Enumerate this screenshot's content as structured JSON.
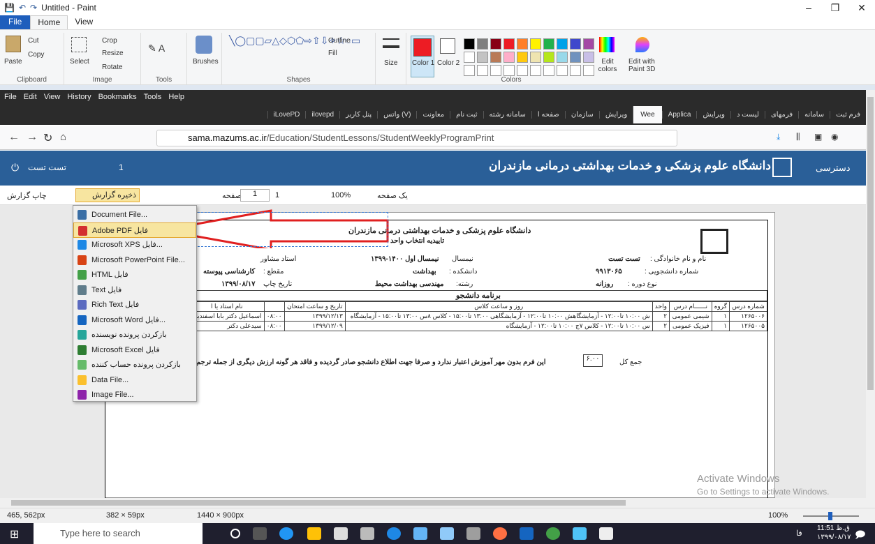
{
  "paint": {
    "title": "Untitled - Paint",
    "tabs": [
      "File",
      "Home",
      "View"
    ],
    "clipboard": {
      "paste": "Paste",
      "cut": "Cut",
      "copy": "Copy",
      "label": "Clipboard"
    },
    "image": {
      "select": "Select",
      "crop": "Crop",
      "resize": "Resize",
      "rotate": "Rotate",
      "label": "Image"
    },
    "tools": {
      "label": "Tools",
      "brushes": "Brushes"
    },
    "shapes": {
      "outline": "Outline",
      "fill": "Fill",
      "label": "Shapes"
    },
    "size": "Size",
    "color1": "Color 1",
    "color2": "Color 2",
    "colors_label": "Colors",
    "edit_colors": "Edit colors",
    "edit_3d": "Edit with Paint 3D",
    "palette": [
      "#000000",
      "#7f7f7f",
      "#880015",
      "#ed1c24",
      "#ff7f27",
      "#fff200",
      "#22b14c",
      "#00a2e8",
      "#3f48cc",
      "#a349a4",
      "#ffffff",
      "#c3c3c3",
      "#b97a57",
      "#ffaec9",
      "#ffc90e",
      "#efe4b0",
      "#b5e61d",
      "#99d9ea",
      "#7092be",
      "#c8bfe7"
    ]
  },
  "firefox": {
    "menu": [
      "File",
      "Edit",
      "View",
      "History",
      "Bookmarks",
      "Tools",
      "Help"
    ],
    "tabs": [
      "فرم ثبت",
      "سامانه",
      "فرمهای",
      "لیست د",
      "ویرایش",
      "Applica",
      "Wee",
      "ویرایش",
      "سازمان",
      "صفحه ا",
      "سامانه رشته",
      "ثبت نام",
      "معاونت",
      "(V) واتس",
      "پنل کاربر",
      "ilovepd",
      "iLovePD"
    ],
    "active_tab": "Wee",
    "url_domain": "sama.mazums.ac.ir",
    "url_path": "/Education/StudentLessons/StudentWeeklyProgramPrint"
  },
  "site": {
    "title": "دانشگاه علوم پزشکی و خدمات بهداشتی درمانی مازندران",
    "access": "دسترسی",
    "user": "تست تست",
    "messages": "1"
  },
  "toolbar": {
    "print": "چاپ گزارش",
    "save": "ذخیره گزارش",
    "page_label": "صفحه",
    "page": "1",
    "of": "1",
    "zoom": "100%",
    "one_page": "یک صفحه"
  },
  "report": {
    "university": "دانشگاه علوم پزشکی و خدمات بهداشتی درمانی مازندران",
    "subtitle": "تاییدیه انتخاب واحد",
    "name_label": "نام و نام خانوادگی :",
    "name": "تست تست",
    "id_label": "شماره دانشجویی :",
    "id": "۹۹۱۳۰۶۵",
    "term_label": "نوع دوره :",
    "term_type": "روزانه",
    "semester_label": "نیمسال",
    "semester": "نیمسال اول ۱۴۰۰-۱۳۹۹",
    "faculty_label": "دانشکده :",
    "faculty": "بهداشت",
    "major_label": "رشته:",
    "major": "مهندسی بهداشت محیط",
    "advisor_label": "استاد مشاور",
    "level_label": "مقطع :",
    "level": "کارشناسی پیوسته",
    "print_date_label": "تاریخ چاپ",
    "print_date": "۱۳۹۹/۰۸/۱۷",
    "program_title": "برنامه دانشجو",
    "headers": [
      "شماره درس",
      "گروه",
      "نــــــام درس",
      "واحد",
      "روز و ساعت کلاس",
      "تاریخ و ساعت امتحان",
      "",
      "نام استاد یا ا"
    ],
    "rows": [
      [
        "۱۲۶۵۰۰۶",
        "۱",
        "شیمی عمومی",
        "۲",
        "ش ۱۰:۰۰ تا۱۲:۰۰ - آزمایشگاهش ۱۰:۰۰ تا۱۲:۰۰ - آزمایشگاهی ۱۳:۰۰ تا۱۵:۰۰ - کلاس ۸س ۱۳:۰۰ تا۱۵:۰۰ - آزمایشگاه",
        "۱۳۹۹/۱۲/۱۳",
        "۰۸:۰۰",
        "اسماعیل دکتر بابا اسفندیار"
      ],
      [
        "۱۲۶۵۰۰۵",
        "۱",
        "فیزیک عمومی",
        "۲",
        "س ۱۰:۰۰ تا۱۲:۰۰ - کلاس ۷ج ۱۰:۰۰ تا۱۲:۰۰ - آزمایشگاه",
        "۱۳۹۹/۱۲/۰۹",
        "۰۸:۰۰",
        "سیدعلی دکتر"
      ]
    ],
    "total_label": "جمع کل",
    "total": "۶.۰۰",
    "footnote": "این فرم بدون مهر آموزش اعتبار ندارد و صرفا جهت اطلاع دانشجو صادر گردیده و فاقد هر گونه ارزش دیگری از جمله ترجم"
  },
  "dropdown": [
    {
      "label": "Document File...",
      "color": "#3a6ea5"
    },
    {
      "label": "Adobe PDF فایل",
      "color": "#d32f2f"
    },
    {
      "label": "Microsoft XPS فایل...",
      "color": "#1e88e5"
    },
    {
      "label": "Microsoft PowerPoint File...",
      "color": "#d84315"
    },
    {
      "label": "HTML فایل",
      "color": "#43a047"
    },
    {
      "label": "Text فایل",
      "color": "#607d8b"
    },
    {
      "label": "Rich Text فایل",
      "color": "#5c6bc0"
    },
    {
      "label": "Microsoft Word فایل...",
      "color": "#1565c0"
    },
    {
      "label": "بازکردن پرونده نویسنده",
      "color": "#26a69a"
    },
    {
      "label": "Microsoft Excel فایل",
      "color": "#2e7d32"
    },
    {
      "label": "بازکردن پرونده حساب کننده",
      "color": "#66bb6a"
    },
    {
      "label": "Data File...",
      "color": "#fbc02d"
    },
    {
      "label": "Image File...",
      "color": "#8e24aa"
    }
  ],
  "watermark": {
    "line1": "Activate Windows",
    "line2": "Go to Settings to activate Windows."
  },
  "status": {
    "pos": "465, 562px",
    "sel": "382 × 59px",
    "size": "1440 × 900px",
    "zoom": "100%"
  },
  "taskbar": {
    "search": "Type here to search",
    "time": "11:51 ق.ظ",
    "date": "۱۳۹۹/۰۸/۱۷",
    "lang": "فا"
  }
}
